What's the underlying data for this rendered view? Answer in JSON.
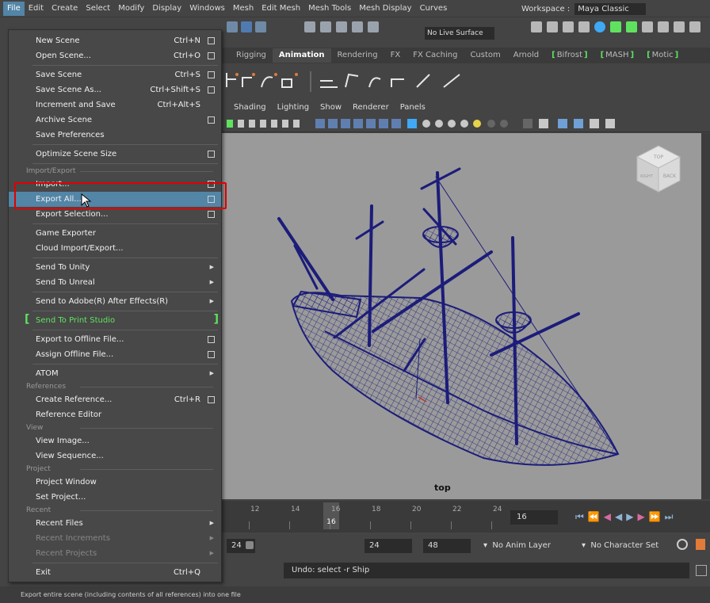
{
  "menubar": {
    "items": [
      "File",
      "Edit",
      "Create",
      "Select",
      "Modify",
      "Display",
      "Windows",
      "Mesh",
      "Edit Mesh",
      "Mesh Tools",
      "Mesh Display",
      "Curves"
    ],
    "workspace_label": "Workspace :",
    "workspace_value": "Maya Classic"
  },
  "toolbar": {
    "live_surface": "No Live Surface"
  },
  "shelf_tabs": [
    "Rigging",
    "Animation",
    "Rendering",
    "FX",
    "FX Caching",
    "Custom",
    "Arnold",
    "Bifrost",
    "MASH",
    "Motic"
  ],
  "panel_menu": [
    "Shading",
    "Lighting",
    "Show",
    "Renderer",
    "Panels"
  ],
  "viewport": {
    "camera_label": "top",
    "viewcube_faces": [
      "TOP",
      "RIGHT",
      "BACK"
    ]
  },
  "file_menu": {
    "items": [
      {
        "label": "New Scene",
        "shortcut": "Ctrl+N",
        "option": true
      },
      {
        "label": "Open Scene...",
        "shortcut": "Ctrl+O",
        "option": true
      },
      {
        "label": "Save Scene",
        "shortcut": "Ctrl+S",
        "option": true
      },
      {
        "label": "Save Scene As...",
        "shortcut": "Ctrl+Shift+S",
        "option": true
      },
      {
        "label": "Increment and Save",
        "shortcut": "Ctrl+Alt+S"
      },
      {
        "label": "Archive Scene",
        "option": true
      },
      {
        "label": "Save Preferences"
      },
      {
        "label": "Optimize Scene Size",
        "option": true
      },
      {
        "section": "Import/Export"
      },
      {
        "label": "Import...",
        "option": true
      },
      {
        "label": "Export All...",
        "option": true,
        "highlight": true
      },
      {
        "label": "Export Selection...",
        "option": true
      },
      {
        "label": "Game Exporter"
      },
      {
        "label": "Cloud Import/Export..."
      },
      {
        "label": "Send To Unity",
        "submenu": true
      },
      {
        "label": "Send To Unreal",
        "submenu": true
      },
      {
        "label": "Send to Adobe(R) After Effects(R)",
        "submenu": true
      },
      {
        "label": "Send To Print Studio",
        "green": true
      },
      {
        "label": "Export to Offline File...",
        "option": true
      },
      {
        "label": "Assign Offline File...",
        "option": true
      },
      {
        "label": "ATOM",
        "submenu": true
      },
      {
        "section": "References"
      },
      {
        "label": "Create Reference...",
        "shortcut": "Ctrl+R",
        "option": true
      },
      {
        "label": "Reference Editor"
      },
      {
        "section": "View"
      },
      {
        "label": "View Image..."
      },
      {
        "label": "View Sequence..."
      },
      {
        "section": "Project"
      },
      {
        "label": "Project Window"
      },
      {
        "label": "Set Project..."
      },
      {
        "section": "Recent"
      },
      {
        "label": "Recent Files",
        "submenu": true
      },
      {
        "label": "Recent Increments",
        "submenu": true,
        "disabled": true
      },
      {
        "label": "Recent Projects",
        "submenu": true,
        "disabled": true
      },
      {
        "label": "Exit",
        "shortcut": "Ctrl+Q"
      }
    ]
  },
  "timeline": {
    "ticks": [
      "12",
      "14",
      "16",
      "18",
      "20",
      "22",
      "24"
    ],
    "current_frame": "16",
    "current_frame_field": "16"
  },
  "range": {
    "start_field": "24",
    "end_field": "24",
    "end_anim": "48",
    "anim_layer": "No Anim Layer",
    "character_set": "No Character Set"
  },
  "cmdline": {
    "undo_text": "Undo: select -r Ship"
  },
  "helpline": {
    "text": "Export entire scene (including contents of all references) into one file"
  },
  "colors": {
    "highlight": "#5285a6",
    "mesh": "#1c1c7a",
    "viewport_bg": "#9a9a9a",
    "green_label": "#5fe35f",
    "red_box": "#e00000"
  }
}
